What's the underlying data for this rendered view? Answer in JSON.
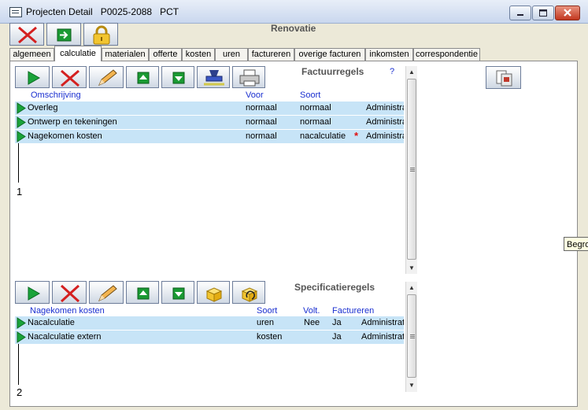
{
  "window": {
    "title": "Projecten Detail   P0025-2088   PCT",
    "controls": [
      "minimize-icon",
      "maximize-icon",
      "close-icon"
    ]
  },
  "header": {
    "project_name": "Renovatie"
  },
  "main_toolbar": [
    "delete-icon",
    "go-next-icon",
    "lock-icon"
  ],
  "tabs": [
    {
      "label": "algemeen"
    },
    {
      "label": "calculatie",
      "active": true
    },
    {
      "label": "materialen"
    },
    {
      "label": "offerte"
    },
    {
      "label": "kosten"
    },
    {
      "label": "uren"
    },
    {
      "label": "factureren"
    },
    {
      "label": "overige facturen"
    },
    {
      "label": "inkomsten"
    },
    {
      "label": "correspondentie"
    }
  ],
  "factuurregels": {
    "title": "Factuurregels",
    "help": "?",
    "toolbar": [
      "play-icon",
      "delete-icon",
      "edit-pencil-icon",
      "move-up-icon",
      "move-down-icon",
      "stamp-icon",
      "printer-icon"
    ],
    "columns": {
      "omschrijving": "Omschrijving",
      "voor": "Voor",
      "soort": "Soort"
    },
    "rows": [
      {
        "omschrijving": "Overleg",
        "voor": "normaal",
        "soort": "normaal",
        "marker": "",
        "extra": "Administra"
      },
      {
        "omschrijving": "Ontwerp en tekeningen",
        "voor": "normaal",
        "soort": "normaal",
        "marker": "",
        "extra": "Administra"
      },
      {
        "omschrijving": "Nagekomen kosten",
        "voor": "normaal",
        "soort": "nacalculatie",
        "marker": "*",
        "extra": "Administra"
      }
    ],
    "count": "1"
  },
  "specificatieregels": {
    "title": "Specificatieregels",
    "toolbar": [
      "play-icon",
      "delete-icon",
      "edit-pencil-icon",
      "move-up-icon",
      "move-down-icon",
      "open-box-icon",
      "box-refresh-icon"
    ],
    "columns": {
      "naam": "Nagekomen kosten",
      "soort": "Soort",
      "volt": "Volt.",
      "factureren": "Factureren"
    },
    "rows": [
      {
        "naam": "Nacalculatie",
        "soort": "uren",
        "volt": "Nee",
        "factureren": "Ja",
        "extra": "Administrati"
      },
      {
        "naam": "Nacalculatie extern",
        "soort": "kosten",
        "volt": "",
        "factureren": "Ja",
        "extra": "Administrati"
      }
    ],
    "count": "2"
  },
  "side_button": "document-icon",
  "tooltip": "Begro"
}
